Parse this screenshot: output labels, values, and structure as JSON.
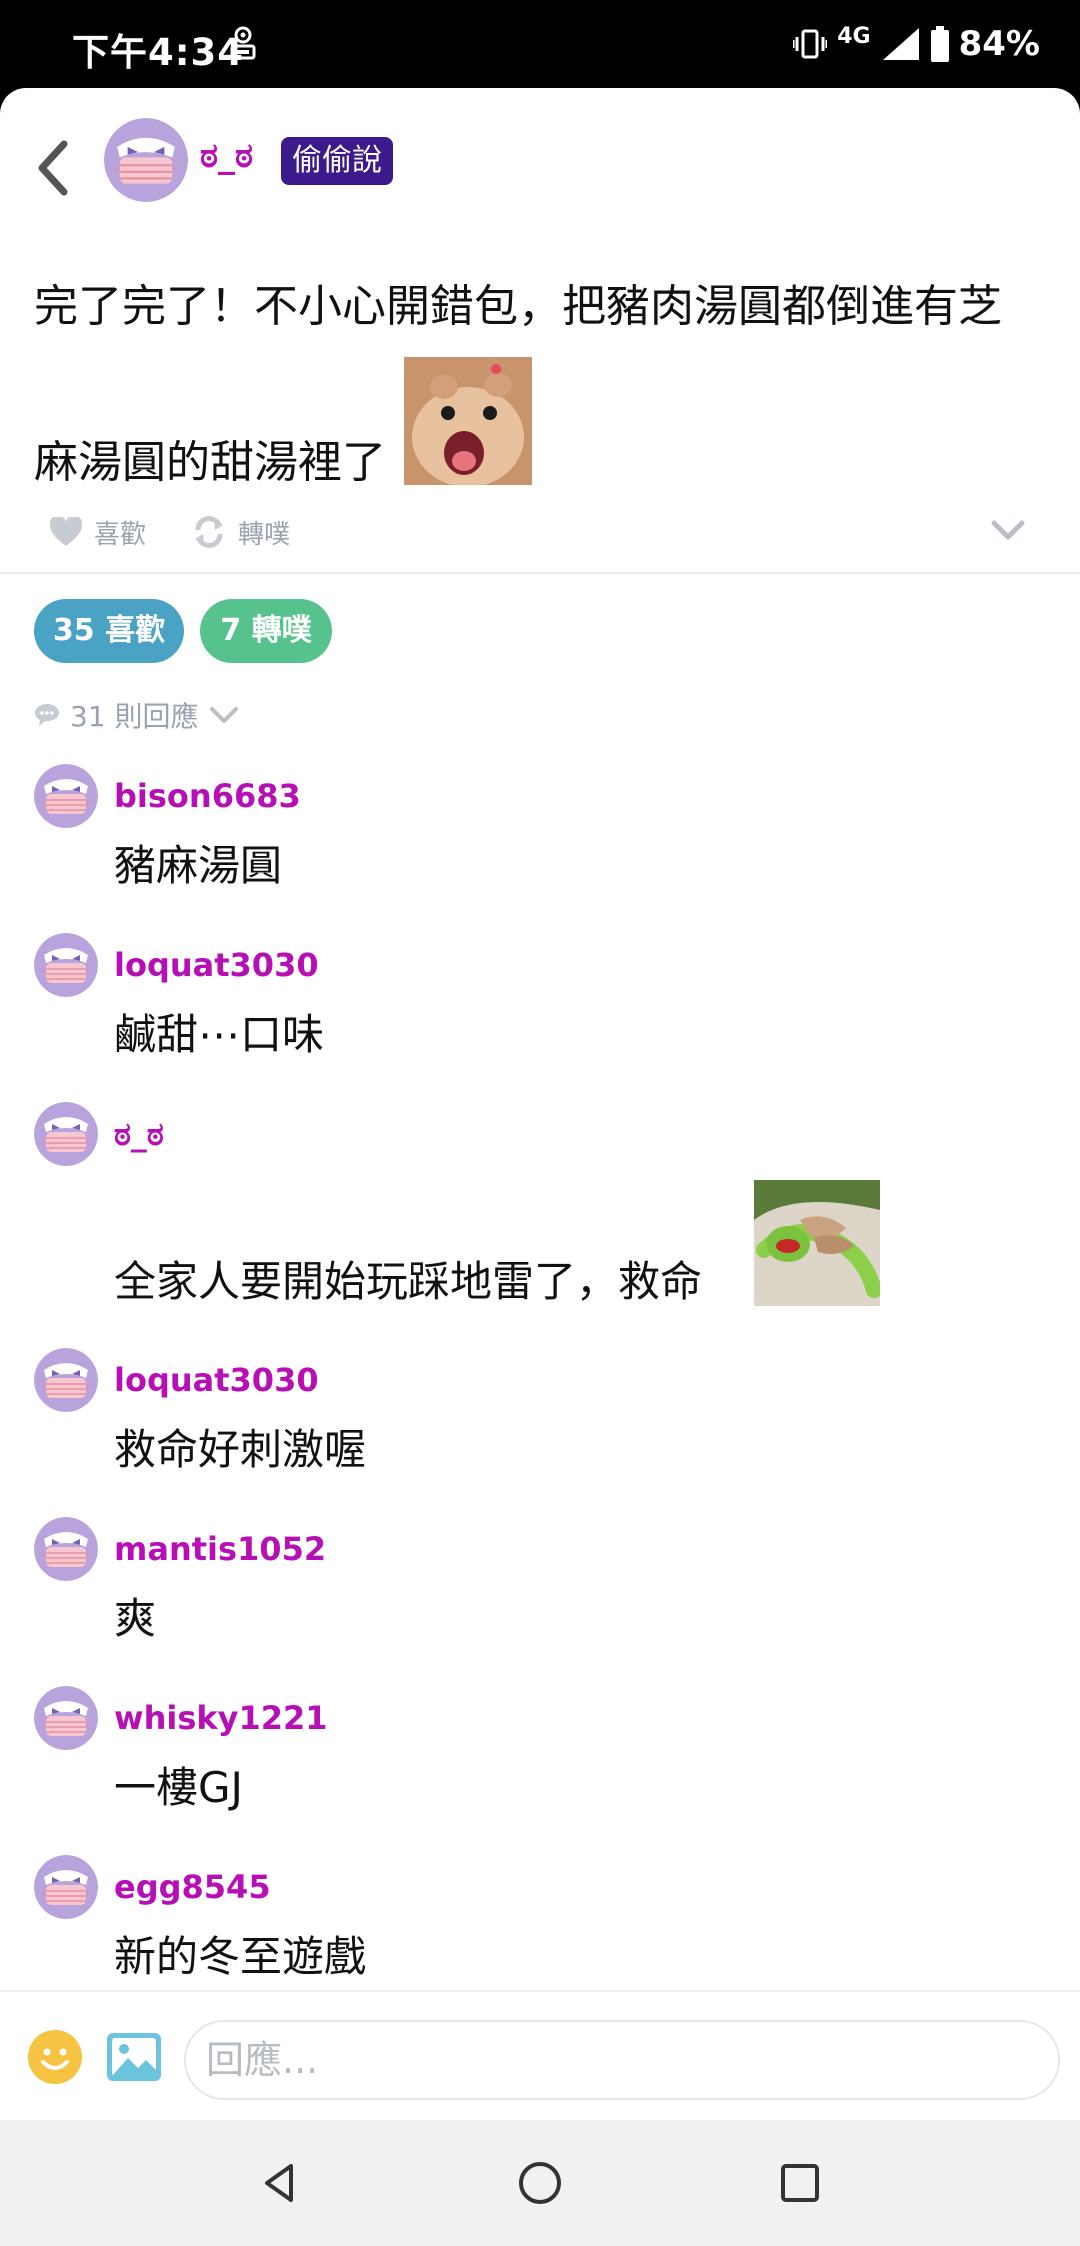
{
  "status_bar": {
    "time": "下午4:34",
    "network": "4G",
    "battery": "84%",
    "icons": [
      "notification-icon",
      "vibrate-icon",
      "signal-icon",
      "battery-icon"
    ]
  },
  "post": {
    "author": "ಠ_ಠ",
    "badge": "偷偷說",
    "text_line1": "完了完了！不小心開錯包，把豬肉湯圓都倒進有芝",
    "text_line2": "麻湯圓的甜湯裡了",
    "image_icon": "hamster-sticker",
    "actions": {
      "like": "喜歡",
      "replurk": "轉噗"
    },
    "stats": {
      "likes_label": "35 喜歡",
      "replurks_label": "7 轉噗"
    },
    "reply_count": "31 則回應"
  },
  "comments": [
    {
      "user": "bison6683",
      "text": "豬麻湯圓"
    },
    {
      "user": "loquat3030",
      "text": "鹹甜⋯口味"
    },
    {
      "user": "ಠ_ಠ",
      "text": "全家人要開始玩踩地雷了，救命",
      "image_icon": "kermit-cpr-sticker"
    },
    {
      "user": "loquat3030",
      "text": "救命好刺激喔"
    },
    {
      "user": "mantis1052",
      "text": "爽"
    },
    {
      "user": "whisky1221",
      "text": "一樓GJ"
    },
    {
      "user": "egg8545",
      "text": "新的冬至遊戲"
    }
  ],
  "reply_bar": {
    "placeholder": "回應..."
  },
  "colors": {
    "username": "#b60fb6",
    "badge_bg": "#3d1a8c",
    "like_pill": "#4aa3c4",
    "replurk_pill": "#56c28e",
    "muted": "#9aa3ad"
  }
}
